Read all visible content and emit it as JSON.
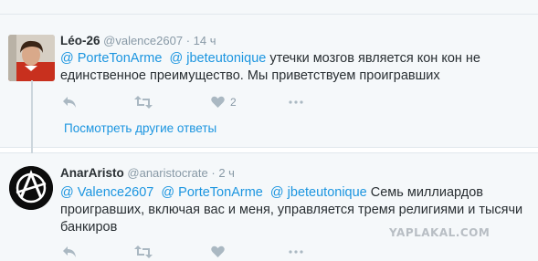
{
  "tweets": [
    {
      "name": "Léo-26",
      "handle": "@valence2607",
      "separator": "·",
      "time": "14 ч",
      "mentions": [
        "@ PorteTonArme",
        "@ jbeteutonique"
      ],
      "body_line1": "утечки мозгов является кон кон не",
      "body_line2": "единственное преимущество. Мы приветствуем проигравших",
      "like_count": "2",
      "show_more": "Посмотреть другие ответы",
      "icons": {
        "reply": "reply-icon",
        "retweet": "retweet-icon",
        "like": "heart-icon",
        "more": "more-icon"
      }
    },
    {
      "name": "AnarAristo",
      "handle": "@anaristocrate",
      "separator": "·",
      "time": "2 ч",
      "mentions": [
        "@ Valence2607",
        "@ PorteTonArme",
        "@ jbeteutonique"
      ],
      "body_line1": "Семь миллиардов",
      "body_line2": "проигравших, включая вас и меня, управляется тремя религиями и тысячи",
      "body_line3": "банкиров",
      "icons": {
        "reply": "reply-icon",
        "retweet": "retweet-icon",
        "like": "heart-icon",
        "more": "more-icon"
      }
    }
  ],
  "watermark": "YAPLAKAL.COM",
  "colors": {
    "link": "#1b95e0",
    "muted": "#8899a6",
    "icon": "#aab8c2",
    "background": "#f5f8fa"
  }
}
